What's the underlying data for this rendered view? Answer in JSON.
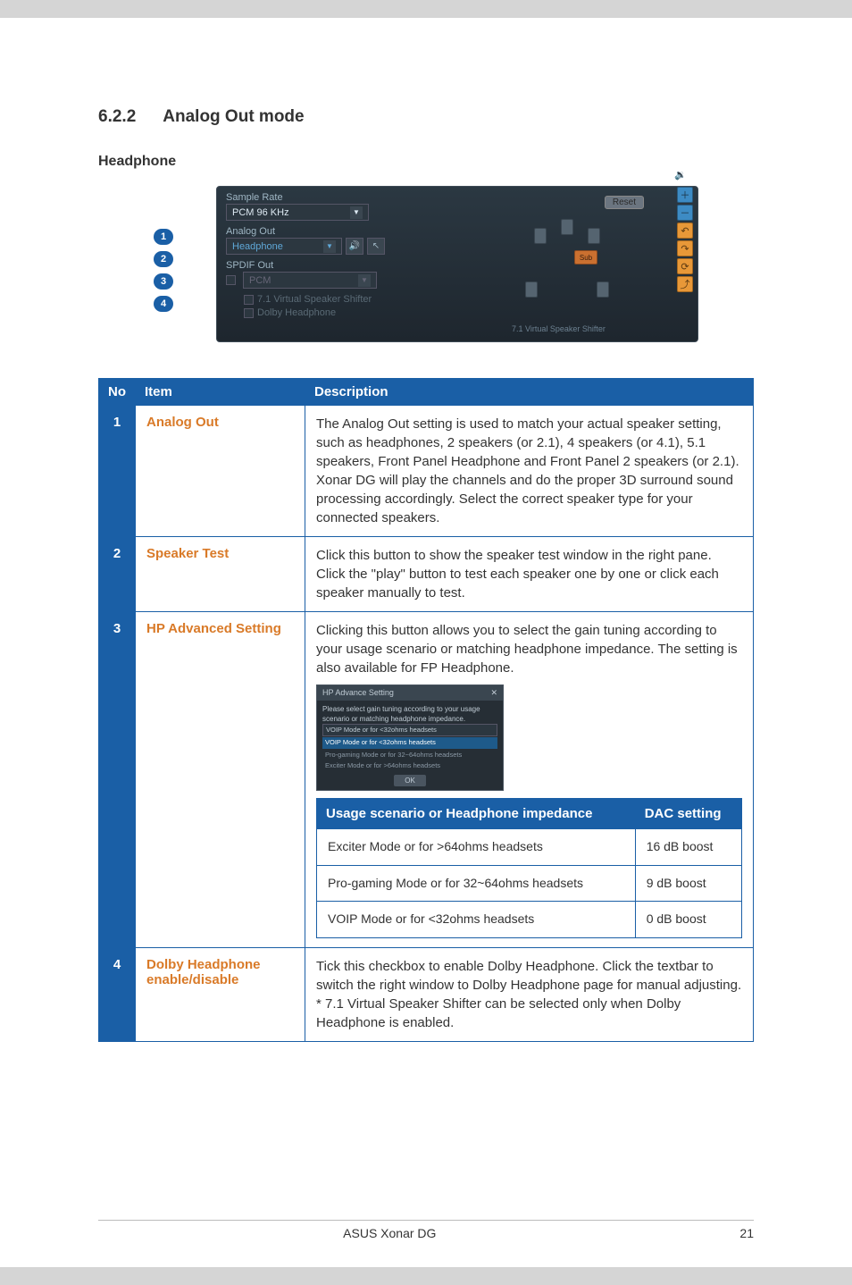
{
  "section": {
    "number": "6.2.2",
    "title": "Analog Out mode"
  },
  "subtitle": "Headphone",
  "panel": {
    "sample_rate_label": "Sample Rate",
    "sample_rate_value": "PCM 96 KHz",
    "analog_out_label": "Analog Out",
    "analog_out_value": "Headphone",
    "spdif_out_label": "SPDIF Out",
    "spdif_out_value": "PCM",
    "opt1": "7.1 Virtual Speaker Shifter",
    "opt2": "Dolby Headphone",
    "reset": "Reset",
    "diag_label": "7.1 Virtual Speaker Shifter",
    "sub": "Sub"
  },
  "callouts": [
    "1",
    "2",
    "3",
    "4"
  ],
  "table": {
    "headers": {
      "no": "No",
      "item": "Item",
      "desc": "Description"
    },
    "rows": [
      {
        "no": "1",
        "item": "Analog Out",
        "desc": "The Analog Out setting is used to match your actual speaker setting, such as headphones, 2 speakers (or 2.1), 4 speakers (or 4.1), 5.1 speakers, Front Panel Headphone and Front Panel 2 speakers (or 2.1). Xonar DG will play the channels and do the proper 3D surround sound processing accordingly. Select the correct speaker type for your connected speakers."
      },
      {
        "no": "2",
        "item": "Speaker Test",
        "desc": "Click this button to show the speaker test window in the right pane. Click the \"play\" button to test each speaker one by one or click each speaker manually to test."
      },
      {
        "no": "3",
        "item": "HP Advanced Setting",
        "desc_intro": "Clicking this button allows you to select the gain tuning according to your usage scenario or matching headphone impedance. The setting is also available for FP Headphone.",
        "dialog": {
          "title": "HP Advance Setting",
          "text": "Please select gain tuning according to your usage scenario or matching headphone impedance.",
          "dd": "VOIP Mode or for <32ohms headsets",
          "sel": "VOIP Mode or for <32ohms headsets",
          "opt1": "Pro-gaming Mode or for 32~64ohms headsets",
          "opt2": "Exciter Mode or for >64ohms headsets",
          "ok": "OK"
        },
        "inner_headers": {
          "scenario": "Usage scenario or Headphone impedance",
          "dac": "DAC setting"
        },
        "inner_rows": [
          {
            "scenario": "Exciter Mode or for >64ohms headsets",
            "dac": "16 dB boost"
          },
          {
            "scenario": "Pro-gaming Mode or for 32~64ohms headsets",
            "dac": "9 dB boost"
          },
          {
            "scenario": "VOIP Mode or for <32ohms headsets",
            "dac": "0 dB boost"
          }
        ]
      },
      {
        "no": "4",
        "item": "Dolby Headphone enable/disable",
        "desc": "Tick this checkbox to enable Dolby Headphone. Click the textbar to switch the right window to Dolby Headphone page for manual adjusting.",
        "note": "* 7.1 Virtual Speaker Shifter can be selected only when Dolby Headphone is enabled."
      }
    ]
  },
  "footer": {
    "product": "ASUS Xonar DG",
    "page": "21"
  }
}
